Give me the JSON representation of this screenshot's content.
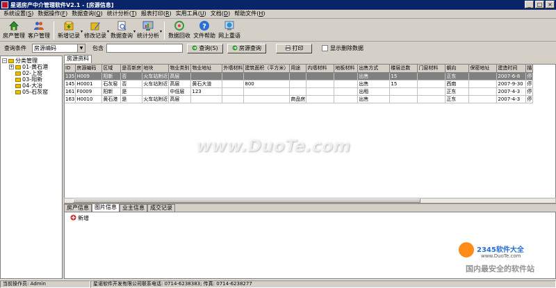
{
  "window": {
    "title": "星诺房产中介管理软件V2.1 - [房源信息]",
    "controls": [
      "_",
      "□",
      "×"
    ]
  },
  "menu": [
    {
      "label": "系统设置",
      "key": "S"
    },
    {
      "label": "数据操作",
      "key": "F"
    },
    {
      "label": "数据查询",
      "key": "Q"
    },
    {
      "label": "统计分析",
      "key": "T"
    },
    {
      "label": "报表打印",
      "key": "R"
    },
    {
      "label": "实用工具",
      "key": "U"
    },
    {
      "label": "文档",
      "key": "D"
    },
    {
      "label": "帮助文件",
      "key": "H"
    }
  ],
  "toolbar": [
    {
      "label": "房产管理",
      "icon": "house-icon",
      "color": "#2e8b2e",
      "dropdown": false
    },
    {
      "label": "客户管理",
      "icon": "people-icon",
      "color": "#3a5fcd",
      "dropdown": false
    },
    {
      "label": "新增记录",
      "icon": "add-record-icon",
      "color": "#cc9a06",
      "dropdown": true
    },
    {
      "label": "修改记录",
      "icon": "edit-record-icon",
      "color": "#cc9a06",
      "dropdown": true
    },
    {
      "label": "数据查询",
      "icon": "query-doc-icon",
      "color": "#6b8fd6",
      "dropdown": true
    },
    {
      "label": "统计分析",
      "icon": "chart-icon",
      "color": "#4a70c8",
      "dropdown": true
    },
    {
      "label": "数据回收",
      "icon": "recycle-icon",
      "color": "#3c9a3c",
      "dropdown": false
    },
    {
      "label": "文件帮助",
      "icon": "help-icon",
      "color": "#2a6fd6",
      "dropdown": false
    },
    {
      "label": "网上重语",
      "icon": "globe-icon",
      "color": "#2a8fd6",
      "dropdown": false
    }
  ],
  "search": {
    "condition_label": "查询条件",
    "condition_value": "房源编码",
    "contains_label": "包含",
    "contains_value": "",
    "query_button": "查询(S)",
    "housing_query_button": "房源查询",
    "print_button": "打印",
    "show_deleted_label": "显示删除数据"
  },
  "tree": {
    "root": "分类管理",
    "items": [
      "01-黄石港",
      "02-上窑",
      "03-阳新",
      "04-大冶",
      "05-石灰窑"
    ]
  },
  "top_tab": "房源资料",
  "table": {
    "columns": [
      "ID",
      "房源编码",
      "区域",
      "是否新房",
      "地块",
      "物业类别",
      "物业地址",
      "外墙材料",
      "建筑面积（平方米）",
      "用途",
      "内墙材料",
      "地板材料",
      "出售方式",
      "楼层总数",
      "门窗材料",
      "朝向",
      "保密地址",
      "建造时间",
      "描"
    ],
    "rows": [
      [
        "135",
        "H009",
        "阳新",
        "否",
        "火车站附近",
        "高层",
        "",
        "",
        "",
        "",
        "",
        "",
        "出售",
        "15",
        "",
        "正东",
        "",
        "2007-6-8",
        "停"
      ],
      [
        "145",
        "H0001",
        "石灰窑",
        "否",
        "火车站附近",
        "高层",
        "黄石大道",
        "",
        "800",
        "",
        "",
        "",
        "出售",
        "15",
        "",
        "西南",
        "",
        "2007-9-30",
        "停"
      ],
      [
        "161",
        "F0009",
        "阳新",
        "是",
        "",
        "中低层",
        "123",
        "",
        "",
        "",
        "",
        "",
        "出租",
        "",
        "",
        "正东",
        "",
        "2007-4-3",
        "停"
      ],
      [
        "163",
        "H0010",
        "黄石港",
        "是",
        "火车站附近",
        "高层",
        "",
        "",
        "",
        "商品房",
        "",
        "",
        "出售",
        "",
        "",
        "正东",
        "",
        "2007-4-3",
        "停"
      ]
    ]
  },
  "bottom_tabs": [
    "房产信息",
    "图片信息",
    "业主信息",
    "成交记录"
  ],
  "bottom_active_tab": 1,
  "sub_add_button": "新增",
  "status": {
    "operator": "当前操作员: Admin",
    "company": "星诺软件开发有限公司联系电话: 0714-6238383; 传真: 0714-6238277"
  },
  "watermarks": {
    "main": "www.DuoTe.com",
    "logo_title": "2345软件大全",
    "logo_url": "www.DuoTe.com",
    "logo_slogan": "国内最安全的软件站"
  }
}
